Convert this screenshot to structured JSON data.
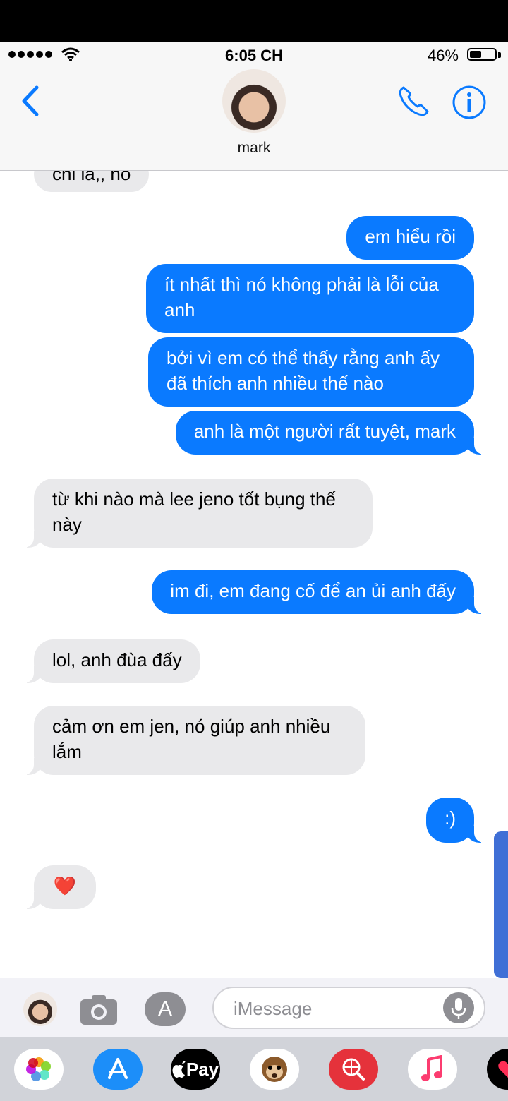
{
  "status_bar": {
    "time": "6:05 CH",
    "battery_percent": "46%",
    "battery_level": 0.46
  },
  "header": {
    "contact_name": "mark"
  },
  "messages": [
    {
      "from": "in",
      "text": "chỉ là,, nó"
    },
    {
      "from": "out",
      "text": "em hiểu rồi"
    },
    {
      "from": "out",
      "text": "ít nhất thì nó không phải là lỗi của anh"
    },
    {
      "from": "out",
      "text": "bởi vì em có thể thấy rằng anh ấy đã thích anh nhiều thế nào"
    },
    {
      "from": "out",
      "text": "anh là một người rất tuyệt, mark"
    },
    {
      "from": "in",
      "text": "từ khi nào mà lee jeno tốt bụng thế này"
    },
    {
      "from": "out",
      "text": "im đi, em đang cố để an ủi anh đấy"
    },
    {
      "from": "in",
      "text": "lol, anh đùa đấy"
    },
    {
      "from": "in",
      "text": "cảm ơn em jen, nó giúp anh nhiều lắm"
    },
    {
      "from": "out",
      "text": ":)"
    },
    {
      "from": "in",
      "text": "❤️"
    }
  ],
  "compose": {
    "placeholder": "iMessage",
    "apps_glyph": "A"
  },
  "dock": {
    "apple_pay_label": "Pay",
    "apps": [
      "photos-icon",
      "app-store-icon",
      "apple-pay-icon",
      "animoji-icon",
      "web-search-icon",
      "music-icon",
      "heart-icon"
    ]
  },
  "colors": {
    "outgoing": "#0a7aff",
    "incoming": "#e9e9eb",
    "tint": "#0a7aff"
  }
}
